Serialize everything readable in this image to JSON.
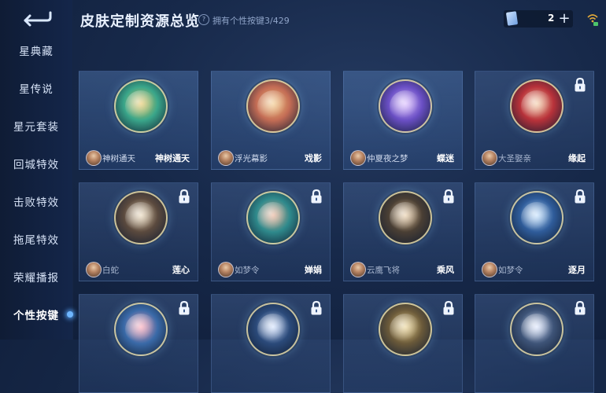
{
  "header": {
    "title": "皮肤定制资源总览",
    "help": "?",
    "subtitle": "拥有个性按键3/429",
    "currency_count": "2",
    "add_label": "+"
  },
  "sidebar": {
    "items": [
      {
        "label": "星典藏"
      },
      {
        "label": "星传说"
      },
      {
        "label": "星元套装"
      },
      {
        "label": "回城特效"
      },
      {
        "label": "击败特效"
      },
      {
        "label": "拖尾特效"
      },
      {
        "label": "荣耀播报"
      },
      {
        "label": "个性按键",
        "active": true
      }
    ]
  },
  "cards": [
    {
      "skin": "神树通天",
      "button": "神树通天",
      "locked": false,
      "color": "#3aa68a",
      "accent": "#e7c35a"
    },
    {
      "skin": "浮光幕影",
      "button": "戏影",
      "locked": false,
      "color": "#c36c55",
      "accent": "#f0c27a"
    },
    {
      "skin": "仲夏夜之梦",
      "button": "蝶迷",
      "locked": false,
      "color": "#6a4fc4",
      "accent": "#d7b6ff"
    },
    {
      "skin": "大圣娶亲",
      "button": "缘起",
      "locked": true,
      "color": "#b8323a",
      "accent": "#f2c9a0"
    },
    {
      "skin": "白蛇",
      "button": "莲心",
      "locked": true,
      "color": "#5b4a3e",
      "accent": "#e8d5b4"
    },
    {
      "skin": "如梦令",
      "button": "婵娟",
      "locked": true,
      "color": "#2f8a8c",
      "accent": "#e9a98a"
    },
    {
      "skin": "云鹰飞将",
      "button": "乘风",
      "locked": true,
      "color": "#4a3f34",
      "accent": "#e8c9a0"
    },
    {
      "skin": "如梦令",
      "button": "逐月",
      "locked": true,
      "color": "#2f5c9a",
      "accent": "#bfe0ff"
    },
    {
      "skin": "",
      "button": "",
      "locked": true,
      "color": "#3a6aa8",
      "accent": "#ff9fb0"
    },
    {
      "skin": "",
      "button": "",
      "locked": true,
      "color": "#2b4a7a",
      "accent": "#cfe0ff"
    },
    {
      "skin": "",
      "button": "",
      "locked": true,
      "color": "#6b5a3a",
      "accent": "#e9d08a"
    },
    {
      "skin": "",
      "button": "",
      "locked": true,
      "color": "#3e5478",
      "accent": "#dbe6ff"
    }
  ]
}
